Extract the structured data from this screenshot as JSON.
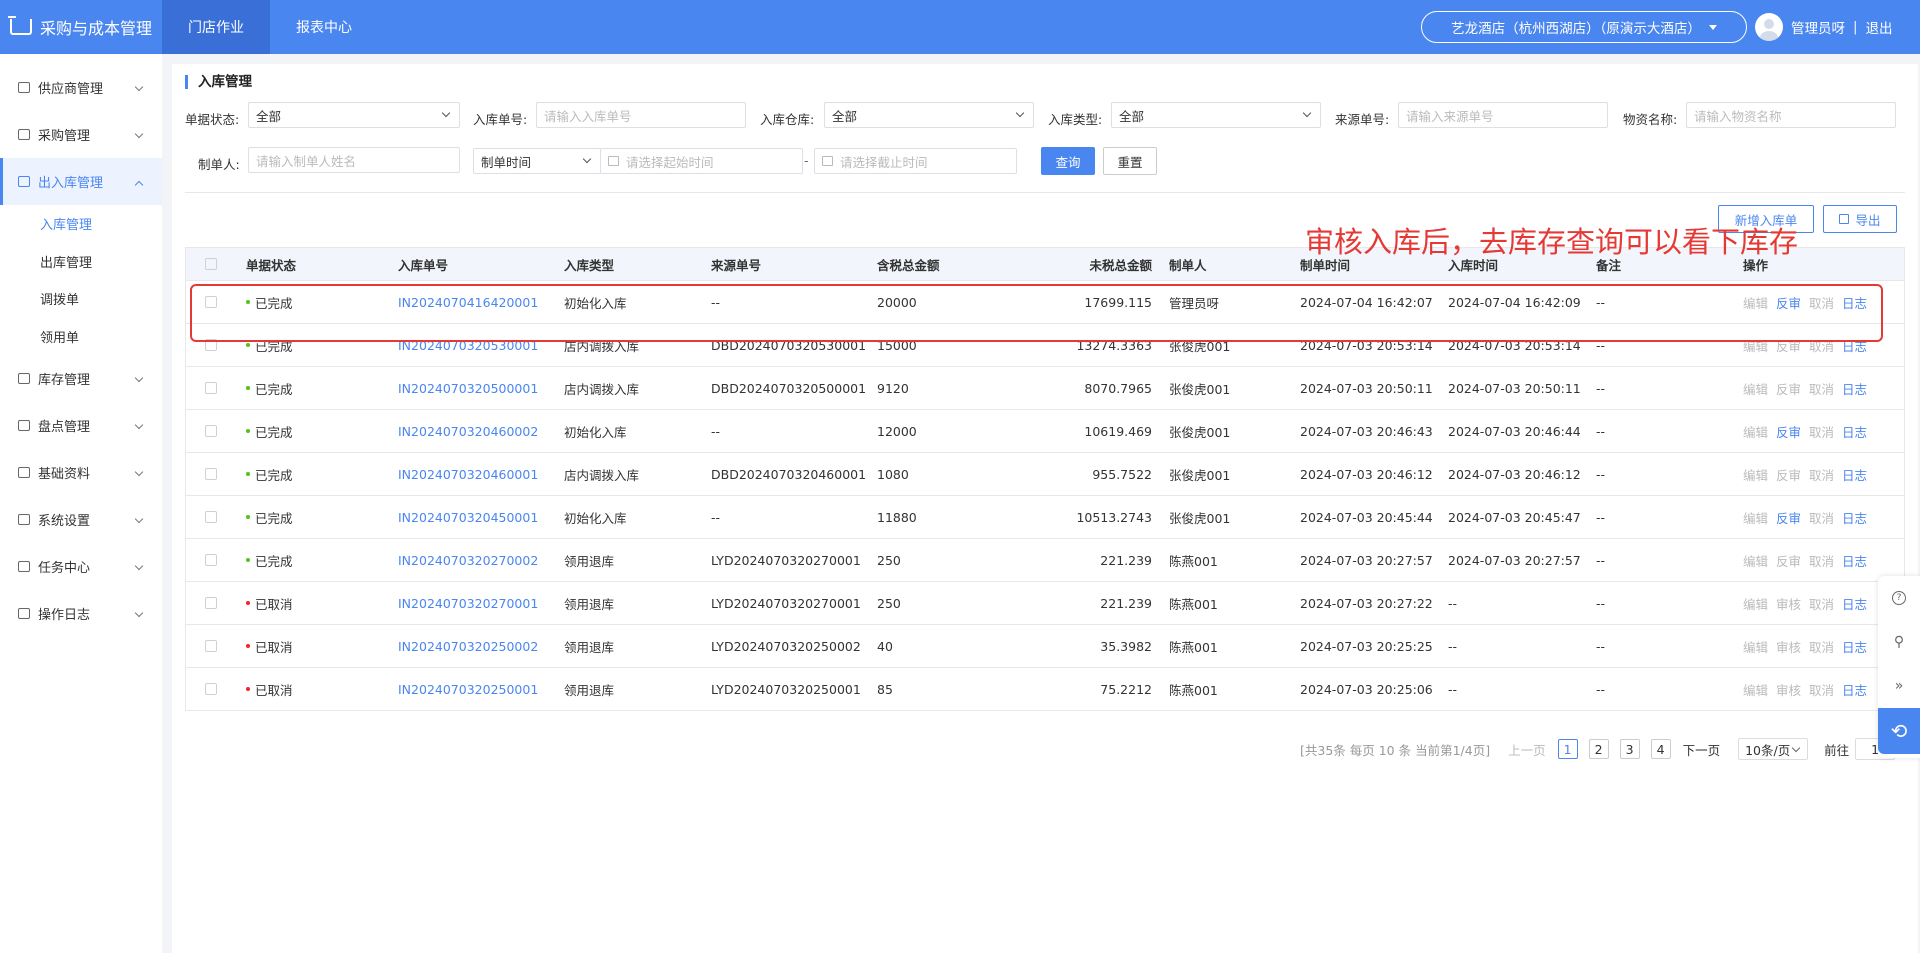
{
  "app": {
    "title": "采购与成本管理"
  },
  "topnav": [
    {
      "label": "门店作业",
      "active": true
    },
    {
      "label": "报表中心",
      "active": false
    }
  ],
  "store": {
    "name": "艺龙酒店（杭州西湖店）（原演示大酒店）"
  },
  "user": {
    "name": "管理员呀",
    "separator": "|",
    "logout": "退出"
  },
  "sidebar": {
    "menus": [
      {
        "label": "供应商管理"
      },
      {
        "label": "采购管理"
      },
      {
        "label": "出入库管理",
        "open": true,
        "children": [
          "入库管理",
          "出库管理",
          "调拨单",
          "领用单"
        ]
      },
      {
        "label": "库存管理"
      },
      {
        "label": "盘点管理"
      },
      {
        "label": "基础资料"
      },
      {
        "label": "系统设置"
      },
      {
        "label": "任务中心"
      },
      {
        "label": "操作日志"
      }
    ],
    "active_sub": "入库管理"
  },
  "page": {
    "title": "入库管理"
  },
  "filters": {
    "status_label": "单据状态:",
    "status_value": "全部",
    "in_no_label": "入库单号:",
    "in_no_placeholder": "请输入入库单号",
    "warehouse_label": "入库仓库:",
    "warehouse_value": "全部",
    "in_type_label": "入库类型:",
    "in_type_value": "全部",
    "src_no_label": "来源单号:",
    "src_no_placeholder": "请输入来源单号",
    "material_label": "物资名称:",
    "material_placeholder": "请输入物资名称",
    "maker_label": "制单人:",
    "maker_placeholder": "请输入制单人姓名",
    "time_type_value": "制单时间",
    "start_placeholder": "请选择起始时间",
    "range_sep": "-",
    "end_placeholder": "请选择截止时间",
    "query_label": "查询",
    "reset_label": "重置"
  },
  "toolbar": {
    "new_label": "新增入库单",
    "export_label": "导出"
  },
  "annotation": {
    "text": "审核入库后，去库存查询可以看下库存"
  },
  "table": {
    "headers": [
      "单据状态",
      "入库单号",
      "入库类型",
      "来源单号",
      "含税总金额",
      "未税总金额",
      "制单人",
      "制单时间",
      "入库时间",
      "备注",
      "操作"
    ],
    "rows": [
      {
        "status": "已完成",
        "status_color": "#52c41a",
        "no": "IN2024070416420001",
        "type": "初始化入库",
        "src": "--",
        "tax": "20000",
        "notax": "17699.115",
        "maker": "管理员呀",
        "ctime": "2024-07-04 16:42:07",
        "itime": "2024-07-04 16:42:09",
        "remark": "--",
        "ops": [
          "编辑",
          "反审",
          "取消",
          "日志"
        ],
        "ops_on": [
          false,
          true,
          false,
          true
        ]
      },
      {
        "status": "已完成",
        "status_color": "#52c41a",
        "no": "IN2024070320530001",
        "type": "店内调拨入库",
        "src": "DBD2024070320530001",
        "tax": "15000",
        "notax": "13274.3363",
        "maker": "张俊虎001",
        "ctime": "2024-07-03 20:53:14",
        "itime": "2024-07-03 20:53:14",
        "remark": "--",
        "ops": [
          "编辑",
          "反审",
          "取消",
          "日志"
        ],
        "ops_on": [
          false,
          false,
          false,
          true
        ]
      },
      {
        "status": "已完成",
        "status_color": "#52c41a",
        "no": "IN2024070320500001",
        "type": "店内调拨入库",
        "src": "DBD2024070320500001",
        "tax": "9120",
        "notax": "8070.7965",
        "maker": "张俊虎001",
        "ctime": "2024-07-03 20:50:11",
        "itime": "2024-07-03 20:50:11",
        "remark": "--",
        "ops": [
          "编辑",
          "反审",
          "取消",
          "日志"
        ],
        "ops_on": [
          false,
          false,
          false,
          true
        ]
      },
      {
        "status": "已完成",
        "status_color": "#52c41a",
        "no": "IN2024070320460002",
        "type": "初始化入库",
        "src": "--",
        "tax": "12000",
        "notax": "10619.469",
        "maker": "张俊虎001",
        "ctime": "2024-07-03 20:46:43",
        "itime": "2024-07-03 20:46:44",
        "remark": "--",
        "ops": [
          "编辑",
          "反审",
          "取消",
          "日志"
        ],
        "ops_on": [
          false,
          true,
          false,
          true
        ]
      },
      {
        "status": "已完成",
        "status_color": "#52c41a",
        "no": "IN2024070320460001",
        "type": "店内调拨入库",
        "src": "DBD2024070320460001",
        "tax": "1080",
        "notax": "955.7522",
        "maker": "张俊虎001",
        "ctime": "2024-07-03 20:46:12",
        "itime": "2024-07-03 20:46:12",
        "remark": "--",
        "ops": [
          "编辑",
          "反审",
          "取消",
          "日志"
        ],
        "ops_on": [
          false,
          false,
          false,
          true
        ]
      },
      {
        "status": "已完成",
        "status_color": "#52c41a",
        "no": "IN2024070320450001",
        "type": "初始化入库",
        "src": "--",
        "tax": "11880",
        "notax": "10513.2743",
        "maker": "张俊虎001",
        "ctime": "2024-07-03 20:45:44",
        "itime": "2024-07-03 20:45:47",
        "remark": "--",
        "ops": [
          "编辑",
          "反审",
          "取消",
          "日志"
        ],
        "ops_on": [
          false,
          true,
          false,
          true
        ]
      },
      {
        "status": "已完成",
        "status_color": "#52c41a",
        "no": "IN2024070320270002",
        "type": "领用退库",
        "src": "LYD2024070320270001",
        "tax": "250",
        "notax": "221.239",
        "maker": "陈燕001",
        "ctime": "2024-07-03 20:27:57",
        "itime": "2024-07-03 20:27:57",
        "remark": "--",
        "ops": [
          "编辑",
          "反审",
          "取消",
          "日志"
        ],
        "ops_on": [
          false,
          false,
          false,
          true
        ]
      },
      {
        "status": "已取消",
        "status_color": "#f5222d",
        "no": "IN2024070320270001",
        "type": "领用退库",
        "src": "LYD2024070320270001",
        "tax": "250",
        "notax": "221.239",
        "maker": "陈燕001",
        "ctime": "2024-07-03 20:27:22",
        "itime": "--",
        "remark": "--",
        "ops": [
          "编辑",
          "审核",
          "取消",
          "日志"
        ],
        "ops_on": [
          false,
          false,
          false,
          true
        ]
      },
      {
        "status": "已取消",
        "status_color": "#f5222d",
        "no": "IN2024070320250002",
        "type": "领用退库",
        "src": "LYD2024070320250002",
        "tax": "40",
        "notax": "35.3982",
        "maker": "陈燕001",
        "ctime": "2024-07-03 20:25:25",
        "itime": "--",
        "remark": "--",
        "ops": [
          "编辑",
          "审核",
          "取消",
          "日志"
        ],
        "ops_on": [
          false,
          false,
          false,
          true
        ]
      },
      {
        "status": "已取消",
        "status_color": "#f5222d",
        "no": "IN2024070320250001",
        "type": "领用退库",
        "src": "LYD2024070320250001",
        "tax": "85",
        "notax": "75.2212",
        "maker": "陈燕001",
        "ctime": "2024-07-03 20:25:06",
        "itime": "--",
        "remark": "--",
        "ops": [
          "编辑",
          "审核",
          "取消",
          "日志"
        ],
        "ops_on": [
          false,
          false,
          false,
          true
        ]
      }
    ]
  },
  "pagination": {
    "summary": "[共35条 每页 10 条 当前第1/4页]",
    "prev": "上一页",
    "pages": [
      "1",
      "2",
      "3",
      "4"
    ],
    "current": "1",
    "next": "下一页",
    "page_size": "10条/页",
    "goto_label": "前往",
    "goto_value": "1"
  },
  "colors": {
    "primary": "#4a86f0",
    "annotation": "#e53935",
    "done": "#52c41a",
    "cancelled": "#f5222d"
  }
}
